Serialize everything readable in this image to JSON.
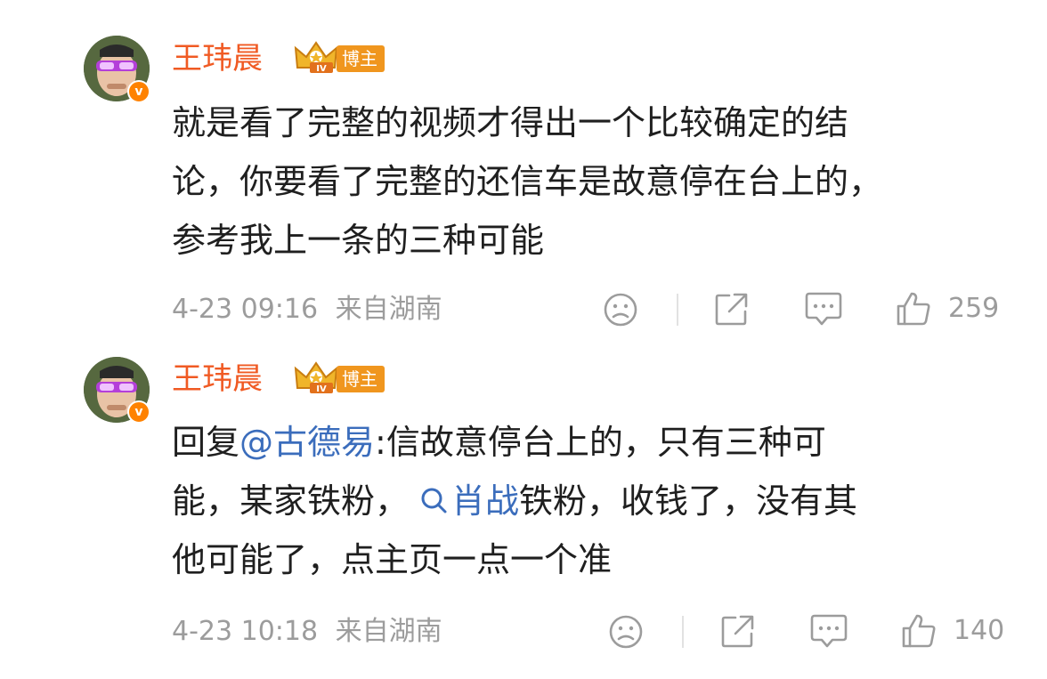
{
  "comments": [
    {
      "author": "王玮晨",
      "role_badge": "博主",
      "text_lines": [
        "就是看了完整的视频才得出一个比较确定的结",
        "论，你要看了完整的还信车是故意停在台上的，",
        "参考我上一条的三种可能"
      ],
      "time": "4-23 09:16",
      "location": "来自湖南",
      "likes": "259"
    },
    {
      "author": "王玮晨",
      "role_badge": "博主",
      "reply_prefix": "回复",
      "mention": "@古德易",
      "line1_rest": ":信故意停台上的，只有三种可",
      "line2_pre": "能，某家铁粉，",
      "topic": "肖战",
      "line2_post": "铁粉，收钱了，没有其",
      "line3": "他可能了，点主页一点一个准",
      "time": "4-23 10:18",
      "location": "来自湖南",
      "likes": "140"
    }
  ],
  "colors": {
    "username": "#f05a23",
    "badge": "#f0961e",
    "verified": "#ff8200",
    "link": "#3b6dbc",
    "meta": "#9c9c9c"
  },
  "icons": {
    "verified": "verified-v-icon",
    "crown": "crown-iv-icon",
    "dislike": "sad-face-icon",
    "share": "share-icon",
    "comment": "comment-bubble-icon",
    "like": "thumbs-up-icon",
    "topic": "search-icon"
  }
}
